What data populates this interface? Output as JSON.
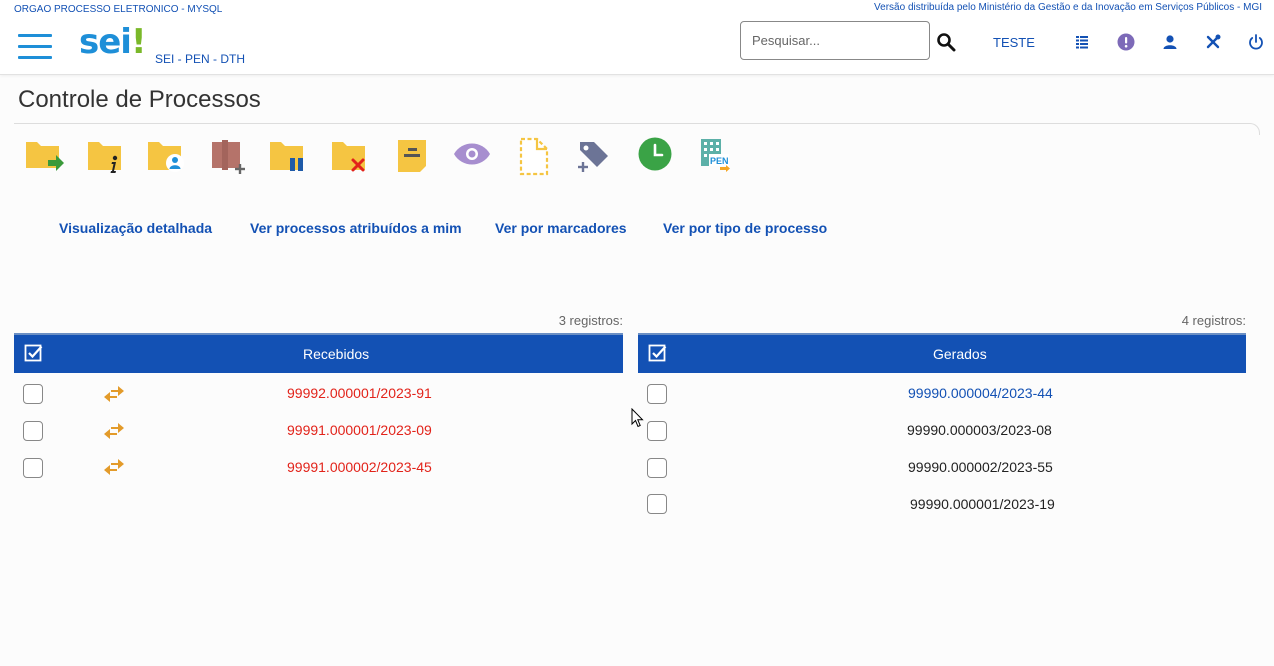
{
  "header": {
    "org_name": "ORGAO PROCESSO ELETRONICO - MYSQL",
    "distribution_note": "Versão distribuída pelo Ministério da Gestão e da Inovação em Serviços Públicos - MGI",
    "logo_text": "sei",
    "logo_mark": "!",
    "system_subtitle": "SEI - PEN - DTH",
    "search_placeholder": "Pesquisar...",
    "unit_label": "TESTE",
    "icons": [
      "menu-icon",
      "search-icon",
      "units-list-icon",
      "notice-icon",
      "user-icon",
      "settings-tools-icon",
      "power-icon"
    ]
  },
  "page": {
    "title": "Controle de Processos"
  },
  "toolbar": {
    "icons": [
      "send-process-icon",
      "process-info-icon",
      "assign-process-icon",
      "new-block-icon",
      "suspend-process-icon",
      "close-process-icon",
      "annotation-icon",
      "follow-up-icon",
      "new-document-icon",
      "add-marker-icon",
      "due-date-clock-icon",
      "pen-icon"
    ]
  },
  "view_links": [
    "Visualização detalhada",
    "Ver processos atribuídos a mim",
    "Ver por marcadores",
    "Ver por tipo de processo"
  ],
  "received": {
    "caption": "3 registros:",
    "header": "Recebidos",
    "rows": [
      {
        "number": "99992.000001/2023-91",
        "status_color": "#e2231a",
        "icon": "exchange-arrows-icon"
      },
      {
        "number": "99991.000001/2023-09",
        "status_color": "#e2231a",
        "icon": "exchange-arrows-icon"
      },
      {
        "number": "99991.000002/2023-45",
        "status_color": "#e2231a",
        "icon": "exchange-arrows-icon"
      }
    ]
  },
  "generated": {
    "caption": "4 registros:",
    "header": "Gerados",
    "rows": [
      {
        "number": "99990.000004/2023-44",
        "status_color": "#1351b4"
      },
      {
        "number": "99990.000003/2023-08",
        "status_color": "#222222"
      },
      {
        "number": "99990.000002/2023-55",
        "status_color": "#222222"
      },
      {
        "number": "99990.000001/2023-19",
        "status_color": "#222222"
      }
    ]
  },
  "colors": {
    "primary_blue": "#1351b4",
    "logo_blue": "#1e8fd8",
    "logo_green": "#7ab829",
    "folder_yellow": "#f5c542",
    "unread_red": "#e2231a"
  }
}
